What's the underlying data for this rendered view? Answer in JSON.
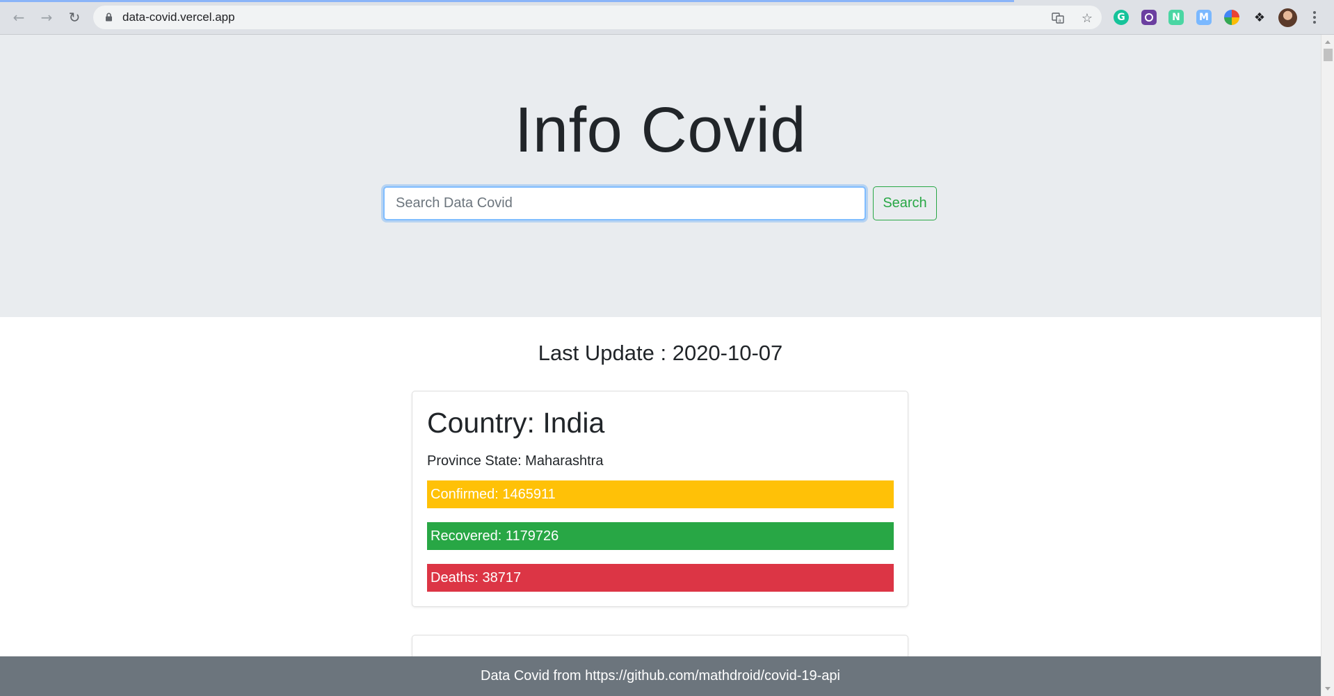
{
  "browser": {
    "url": "data-covid.vercel.app",
    "load_progress": 0.76
  },
  "hero": {
    "title": "Info Covid",
    "search_placeholder": "Search Data Covid",
    "search_button": "Search"
  },
  "last_update": "Last Update : 2020-10-07",
  "cards": [
    {
      "country": "Country: India",
      "province": "Province State: Maharashtra",
      "confirmed": "Confirmed: 1465911",
      "recovered": "Recovered: 1179726",
      "deaths": "Deaths: 38717"
    }
  ],
  "footer": "Data Covid from https://github.com/mathdroid/covid-19-api",
  "colors": {
    "confirmed": "#ffc107",
    "recovered": "#28a745",
    "deaths": "#dc3545",
    "jumbotron": "#e9ecef",
    "footer": "#6c757d"
  },
  "icons": [
    "back-icon",
    "forward-icon",
    "reload-icon",
    "lock-icon",
    "translate-icon",
    "star-icon",
    "grammarly-icon",
    "extension-icon",
    "puzzle-icon",
    "menu-icon"
  ]
}
